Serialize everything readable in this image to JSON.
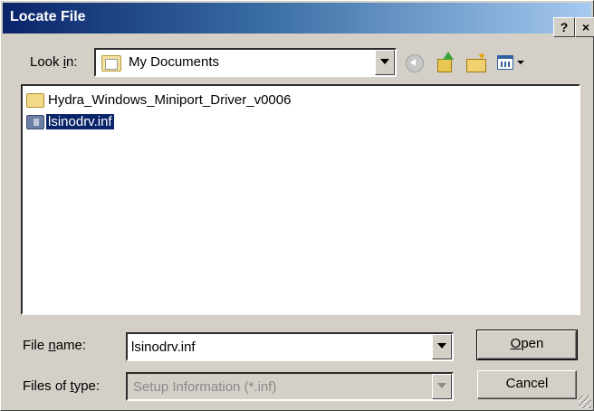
{
  "window": {
    "title": "Locate File",
    "help_label": "?",
    "close_label": "×"
  },
  "look_in": {
    "label_pre": "Look ",
    "label_u": "i",
    "label_post": "n:",
    "value": "My Documents"
  },
  "toolbar": {
    "icons": [
      "back-icon",
      "up-folder-icon",
      "new-folder-icon",
      "views-menu-icon"
    ]
  },
  "files": [
    {
      "name": "Hydra_Windows_Miniport_Driver_v0006",
      "type": "folder"
    },
    {
      "name": "lsinodrv.inf",
      "type": "file",
      "selected": true
    }
  ],
  "file_name": {
    "label_pre": "File ",
    "label_u": "n",
    "label_post": "ame:",
    "value": "lsinodrv.inf"
  },
  "file_type": {
    "label_pre": "Files of ",
    "label_u": "t",
    "label_post": "ype:",
    "value": "Setup Information (*.inf)"
  },
  "buttons": {
    "open_u": "O",
    "open_rest": "pen",
    "cancel": "Cancel"
  },
  "colors": {
    "titlebar_start": "#0a246a",
    "titlebar_end": "#a6caf0",
    "selection": "#0a246a",
    "face": "#d4d0c8"
  }
}
